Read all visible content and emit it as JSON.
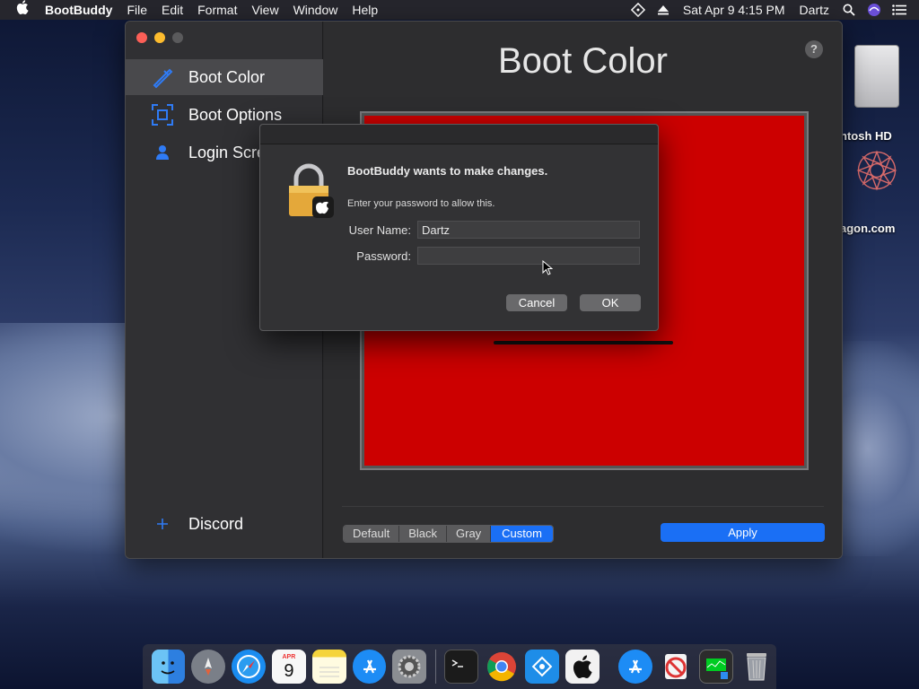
{
  "menubar": {
    "apple": "",
    "app_name": "BootBuddy",
    "menus": [
      "File",
      "Edit",
      "Format",
      "View",
      "Window",
      "Help"
    ],
    "datetime": "Sat Apr 9  4:15 PM",
    "user": "Dartz"
  },
  "desktop": {
    "icons": [
      {
        "label": "ntosh HD",
        "icon": "hard-drive-icon"
      },
      {
        "label": "agon.com",
        "icon": "rosette-icon"
      }
    ]
  },
  "sidebar": {
    "items": [
      {
        "label": "Boot Color",
        "icon": "brush-icon",
        "selected": true
      },
      {
        "label": "Boot Options",
        "icon": "boot-options-icon",
        "selected": false
      },
      {
        "label": "Login Scre",
        "icon": "person-icon",
        "selected": false
      }
    ],
    "discord": {
      "label": "Discord",
      "icon": "plus-icon"
    }
  },
  "main": {
    "title": "Boot Color",
    "help": "?",
    "preview_color": "#cc0000",
    "segments": [
      {
        "label": "Default",
        "active": false
      },
      {
        "label": "Black",
        "active": false
      },
      {
        "label": "Gray",
        "active": false
      },
      {
        "label": "Custom",
        "active": true
      }
    ],
    "apply_label": "Apply"
  },
  "dialog": {
    "heading": "BootBuddy wants to make changes.",
    "subtext": "Enter your password to allow this.",
    "username_label": "User Name:",
    "username_value": "Dartz",
    "password_label": "Password:",
    "password_value": "",
    "cancel_label": "Cancel",
    "ok_label": "OK"
  },
  "dock": {
    "apps": [
      "finder",
      "launchpad",
      "safari",
      "calendar",
      "notes",
      "app-store",
      "system-preferences",
      "terminal",
      "chrome",
      "teamviewer",
      "bootcamp",
      "app-store-2",
      "no-entry",
      "activity",
      "trash"
    ],
    "calendar_month": "APR",
    "calendar_day": "9"
  },
  "colors": {
    "accent": "#1a6ff5",
    "preview_red": "#cc0000"
  }
}
